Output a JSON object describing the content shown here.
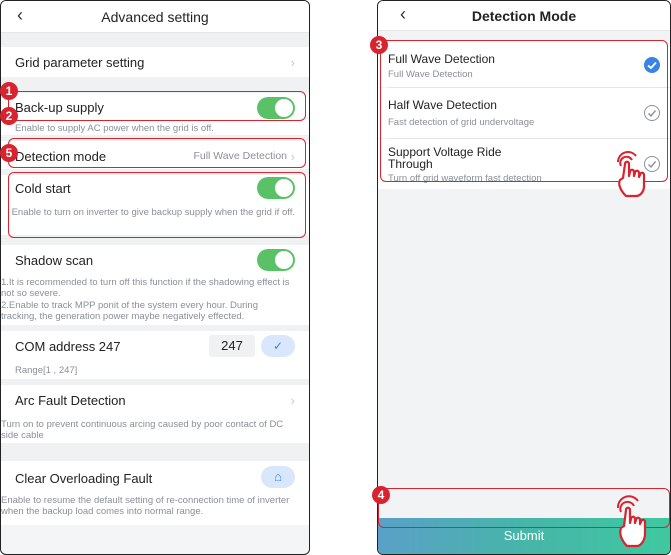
{
  "left": {
    "title": "Advanced setting",
    "back_icon": "‹",
    "grid_param": "Grid  parameter setting",
    "backup_supply": {
      "label": "Back-up supply",
      "desc": "Enable to supply AC power when the grid is off.",
      "on": true
    },
    "detection_mode": {
      "label": "Detection mode",
      "value": "Full Wave Detection"
    },
    "cold_start": {
      "label": "Cold start",
      "desc": "Enable to turn on inverter to give backup supply when the grid if off.",
      "on": true
    },
    "shadow_scan": {
      "label": "Shadow scan",
      "desc1": "1.It is recommended to turn off this function if the shadowing effect is not so severe.",
      "desc2": "2.Enable to track MPP ponit of the system every hour. During tracking, the generation power maybe negatively effected.",
      "on": true
    },
    "com_address": {
      "label": "COM address 247",
      "value": "247",
      "range": "Range[1 , 247]"
    },
    "arc_fault": {
      "label": "Arc Fault Detection",
      "desc": "Turn on to prevent continuous arcing caused by poor contact of DC side cable"
    },
    "clear_overload": {
      "label": "Clear Overloading Fault",
      "desc": "Enable to resume the default setting of re-connection time of inverter when the backup load comes into normal range."
    }
  },
  "right": {
    "title": "Detection Mode",
    "back_icon": "‹",
    "options": [
      {
        "label": "Full Wave Detection",
        "desc": "Full Wave Detection",
        "selected": true
      },
      {
        "label": "Half Wave Detection",
        "desc": "Fast detection of grid undervoltage",
        "selected": false
      },
      {
        "label": "Support Voltage Ride Through",
        "desc": "Turn off grid waveform fast detection",
        "selected": false
      }
    ],
    "submit": "Submit"
  },
  "badges": {
    "b1": "1",
    "b2": "2",
    "b3": "3",
    "b4": "4",
    "b5": "5"
  },
  "colors": {
    "accent_red": "#d9232e",
    "toggle_green": "#5ac266",
    "check_blue": "#3b82e6"
  }
}
